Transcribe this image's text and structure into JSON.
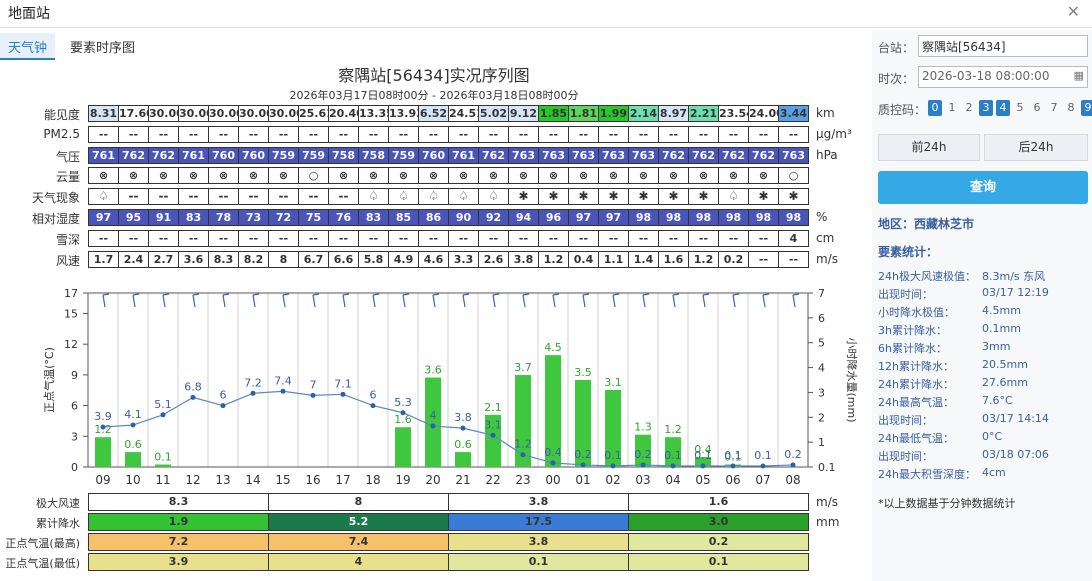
{
  "window_title": "地面站",
  "tabs": [
    "天气钟",
    "要素时序图"
  ],
  "title": "察隅站[56434]实况序列图",
  "subtitle": "2026年03月17日08时00分 - 2026年03月18日08时00分",
  "rows": [
    {
      "label": "能见度",
      "unit": "km",
      "values": [
        "8.31",
        "17.60",
        "30.00",
        "30.00",
        "30.00",
        "30.00",
        "30.00",
        "25.61",
        "20.40",
        "13.35",
        "13.93",
        "6.52",
        "24.51",
        "5.02",
        "9.12",
        "1.85",
        "1.81",
        "1.99",
        "2.14",
        "8.97",
        "2.21",
        "23.54",
        "24.00",
        "3.44"
      ],
      "colors": [
        "#d6e6f7",
        "#fff",
        "#fff",
        "#fff",
        "#fff",
        "#fff",
        "#fff",
        "#fff",
        "#fff",
        "#fff",
        "#fff",
        "#d6e6f7",
        "#fff",
        "#d6e6f7",
        "#d6e6f7",
        "#29c829",
        "#5dd85d",
        "#29c829",
        "#6ee0b0",
        "#d6e6f7",
        "#6ee0b0",
        "#fff",
        "#fff",
        "#5aa0e6"
      ]
    },
    {
      "label": "PM2.5",
      "unit": "μg/m³",
      "values": [
        "--",
        "--",
        "--",
        "--",
        "--",
        "--",
        "--",
        "--",
        "--",
        "--",
        "--",
        "--",
        "--",
        "--",
        "--",
        "--",
        "--",
        "--",
        "--",
        "--",
        "--",
        "--",
        "--",
        "--"
      ]
    },
    {
      "label": "气压",
      "unit": "hPa",
      "values": [
        "761",
        "762",
        "762",
        "761",
        "760",
        "760",
        "759",
        "759",
        "758",
        "758",
        "759",
        "760",
        "761",
        "762",
        "763",
        "763",
        "763",
        "763",
        "763",
        "762",
        "762",
        "762",
        "762",
        "763"
      ],
      "dark": true
    },
    {
      "label": "云量",
      "unit": "",
      "values": [
        "⊗",
        "⊗",
        "⊗",
        "⊗",
        "⊗",
        "⊗",
        "⊗",
        "○",
        "⊗",
        "⊗",
        "⊗",
        "⊗",
        "⊗",
        "⊗",
        "⊗",
        "⊗",
        "⊗",
        "⊗",
        "⊗",
        "⊗",
        "⊗",
        "⊗",
        "⊗",
        "○"
      ]
    },
    {
      "label": "天气现象",
      "unit": "",
      "values": [
        "♤",
        "--",
        "--",
        "--",
        "--",
        "--",
        "--",
        "--",
        "--",
        "♤",
        "♤",
        "♤",
        "♤",
        "♤",
        "✱",
        "✱",
        "✱",
        "✱",
        "✱",
        "✱",
        "✱",
        "♤",
        "✱",
        "✱"
      ]
    },
    {
      "label": "相对湿度",
      "unit": "%",
      "values": [
        "97",
        "95",
        "91",
        "83",
        "78",
        "73",
        "72",
        "75",
        "76",
        "83",
        "85",
        "86",
        "90",
        "92",
        "94",
        "96",
        "97",
        "97",
        "98",
        "98",
        "98",
        "98",
        "98",
        "98"
      ],
      "dark": true
    },
    {
      "label": "雪深",
      "unit": "cm",
      "values": [
        "--",
        "--",
        "--",
        "--",
        "--",
        "--",
        "--",
        "--",
        "--",
        "--",
        "--",
        "--",
        "--",
        "--",
        "--",
        "--",
        "--",
        "--",
        "--",
        "--",
        "--",
        "--",
        "--",
        "4"
      ]
    },
    {
      "label": "风速",
      "unit": "m/s",
      "values": [
        "1.7",
        "2.4",
        "2.7",
        "3.6",
        "8.3",
        "8.2",
        "8",
        "6.7",
        "6.6",
        "5.8",
        "4.9",
        "4.6",
        "3.3",
        "2.6",
        "3.8",
        "1.2",
        "0.4",
        "1.1",
        "1.4",
        "1.6",
        "1.2",
        "0.2",
        "--",
        "--"
      ]
    }
  ],
  "chart_data": {
    "type": "bar",
    "categories": [
      "09",
      "10",
      "11",
      "12",
      "13",
      "14",
      "15",
      "16",
      "17",
      "18",
      "19",
      "20",
      "21",
      "22",
      "23",
      "00",
      "01",
      "02",
      "03",
      "04",
      "05",
      "06",
      "07",
      "08"
    ],
    "temperature": [
      3.9,
      4.1,
      5.1,
      6.8,
      6,
      7.2,
      7.4,
      7,
      7.1,
      6,
      5.3,
      4,
      3.8,
      3.1,
      1.2,
      0.4,
      0.2,
      0.1,
      0.2,
      0.1,
      0.1,
      0.1,
      0.1,
      0.2
    ],
    "precipitation": [
      1.2,
      0.6,
      0.1,
      null,
      null,
      null,
      null,
      null,
      null,
      null,
      1.6,
      3.6,
      0.6,
      2.1,
      3.7,
      4.5,
      3.5,
      3.1,
      1.3,
      1.2,
      0.4,
      0.1,
      null,
      null
    ],
    "ylabel": "正点气温(°C)",
    "ylabel_right": "小时降水量(mm)",
    "left_ticks": [
      "17",
      "15",
      "12",
      "9",
      "6",
      "3",
      "0"
    ],
    "right_ticks": [
      "7",
      "6",
      "5",
      "4",
      "3",
      "2",
      "1",
      "0.1"
    ],
    "ylim": [
      0,
      17
    ],
    "ylim_right": [
      0,
      7
    ]
  },
  "bottom": {
    "segments": [
      "09-14",
      "15-20",
      "21-02",
      "03-08"
    ],
    "rows": [
      {
        "label": "极大风速",
        "unit": "m/s",
        "values": [
          "8.3",
          "8",
          "3.8",
          "1.6"
        ],
        "colors": [
          "#fff",
          "#fff",
          "#fff",
          "#fff"
        ]
      },
      {
        "label": "累计降水",
        "unit": "mm",
        "values": [
          "1.9",
          "5.2",
          "17.5",
          "3.0"
        ],
        "colors": [
          "#34c234",
          "#1a7a4a",
          "#3a7bd5",
          "#2aa02a"
        ]
      },
      {
        "label": "正点气温(最高)",
        "unit": "",
        "values": [
          "7.2",
          "7.4",
          "3.8",
          "0.2"
        ],
        "colors": [
          "#f5c16a",
          "#f5c16a",
          "#e8e08a",
          "#e0e8a0"
        ]
      },
      {
        "label": "正点气温(最低)",
        "unit": "",
        "values": [
          "3.9",
          "4",
          "0.1",
          "0.1"
        ],
        "colors": [
          "#e8e08a",
          "#e8e08a",
          "#e0e8a0",
          "#e0e8a0"
        ]
      }
    ]
  },
  "side": {
    "station_label": "台站：",
    "station_value": "察隅站[56434]",
    "time_label": "时次：",
    "time_value": "2026-03-18 08:00:00",
    "qc_label": "质控码：",
    "qc_codes": [
      "0",
      "1",
      "2",
      "3",
      "4",
      "5",
      "6",
      "7",
      "8",
      "9"
    ],
    "qc_active": [
      "0",
      "3",
      "4",
      "9"
    ],
    "prev_btn": "前24h",
    "next_btn": "后24h",
    "query_btn": "查询",
    "region": "地区：西藏林芝市",
    "stats_title": "要素统计：",
    "stats": [
      {
        "k": "24h极大风速极值：",
        "v": "8.3m/s 东风"
      },
      {
        "k": "出现时间：",
        "v": "03/17 12:19"
      },
      {
        "k": "小时降水极值：",
        "v": "4.5mm"
      },
      {
        "k": "3h累计降水：",
        "v": "0.1mm"
      },
      {
        "k": "6h累计降水：",
        "v": "3mm"
      },
      {
        "k": "12h累计降水：",
        "v": "20.5mm"
      },
      {
        "k": "24h累计降水：",
        "v": "27.6mm"
      },
      {
        "k": "24h最高气温：",
        "v": "7.6°C"
      },
      {
        "k": "出现时间：",
        "v": "03/17 14:14"
      },
      {
        "k": "24h最低气温：",
        "v": "0°C"
      },
      {
        "k": "出现时间：",
        "v": "03/18 07:06"
      },
      {
        "k": "24h最大积雪深度：",
        "v": "4cm"
      }
    ],
    "footnote": "*以上数据基于分钟数据统计"
  }
}
